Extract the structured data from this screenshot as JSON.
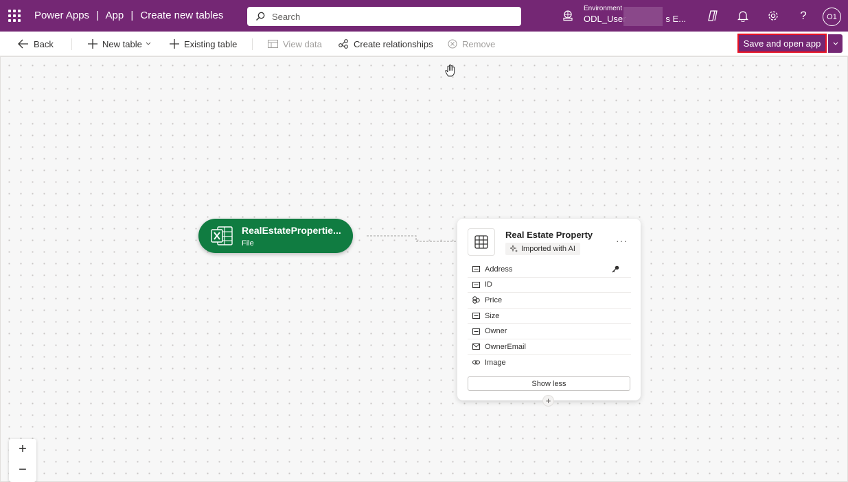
{
  "header": {
    "app_name": "Power Apps",
    "sep1": "|",
    "crumb_app": "App",
    "sep2": "|",
    "crumb_page": "Create new tables",
    "search_placeholder": "Search",
    "environment_label": "Environment",
    "environment_name": "ODL_User",
    "environment_suffix": "s E...",
    "avatar_initials": "O1"
  },
  "toolbar": {
    "back": "Back",
    "new_table": "New table",
    "existing_table": "Existing table",
    "view_data": "View data",
    "create_relationships": "Create relationships",
    "remove": "Remove",
    "save_open": "Save and open app"
  },
  "canvas": {
    "file_node": {
      "name": "RealEstatePropertie...",
      "type": "File"
    },
    "table_card": {
      "title": "Real Estate Property",
      "badge": "Imported with AI",
      "more": "···",
      "columns": [
        {
          "name": "Address",
          "icon": "text-icon",
          "key": true
        },
        {
          "name": "ID",
          "icon": "text-icon",
          "key": false
        },
        {
          "name": "Price",
          "icon": "currency-icon",
          "key": false
        },
        {
          "name": "Size",
          "icon": "text-icon",
          "key": false
        },
        {
          "name": "Owner",
          "icon": "text-icon",
          "key": false
        },
        {
          "name": "OwnerEmail",
          "icon": "email-icon",
          "key": false
        },
        {
          "name": "Image",
          "icon": "link-icon",
          "key": false
        }
      ],
      "show_less": "Show less"
    },
    "zoom_in": "+",
    "zoom_out": "−"
  },
  "colors": {
    "brand": "#742774",
    "excel_green": "#107c41",
    "highlight": "#e81123"
  }
}
